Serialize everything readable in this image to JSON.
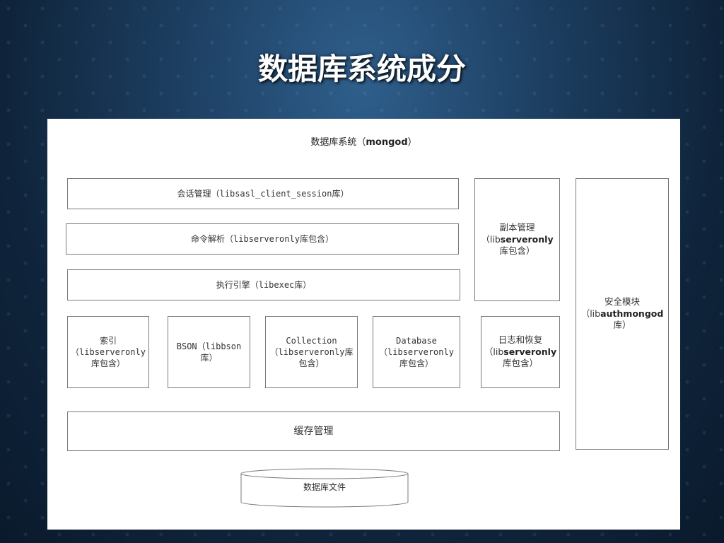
{
  "slide": {
    "title": "数据库系统成分"
  },
  "diagram": {
    "title_prefix": "数据库系统（",
    "title_bold": "mongod",
    "title_suffix": "）",
    "boxes": {
      "session": "会话管理（libsasl_client_session库）",
      "command": "命令解析（libserveronly库包含）",
      "exec": "执行引擎（libexec库）",
      "replica_line1": "副本管理",
      "replica_pre": "（lib",
      "replica_bold": "serveronly",
      "replica_line3": "库包含）",
      "security_line1": "安全模块",
      "security_pre": "（lib",
      "security_bold": "authmongod",
      "security_line3": "库）",
      "index": "索引（libserveronly库包含）",
      "bson": "BSON（libbson库）",
      "collection": "Collection（libserveronly库包含）",
      "database": "Database（libserveronly库包含）",
      "journal_line1": "日志和恢复",
      "journal_pre": "（lib",
      "journal_bold": "serveronly",
      "journal_line3": "库包含）",
      "cache": "缓存管理",
      "dbfile": "数据库文件"
    }
  }
}
